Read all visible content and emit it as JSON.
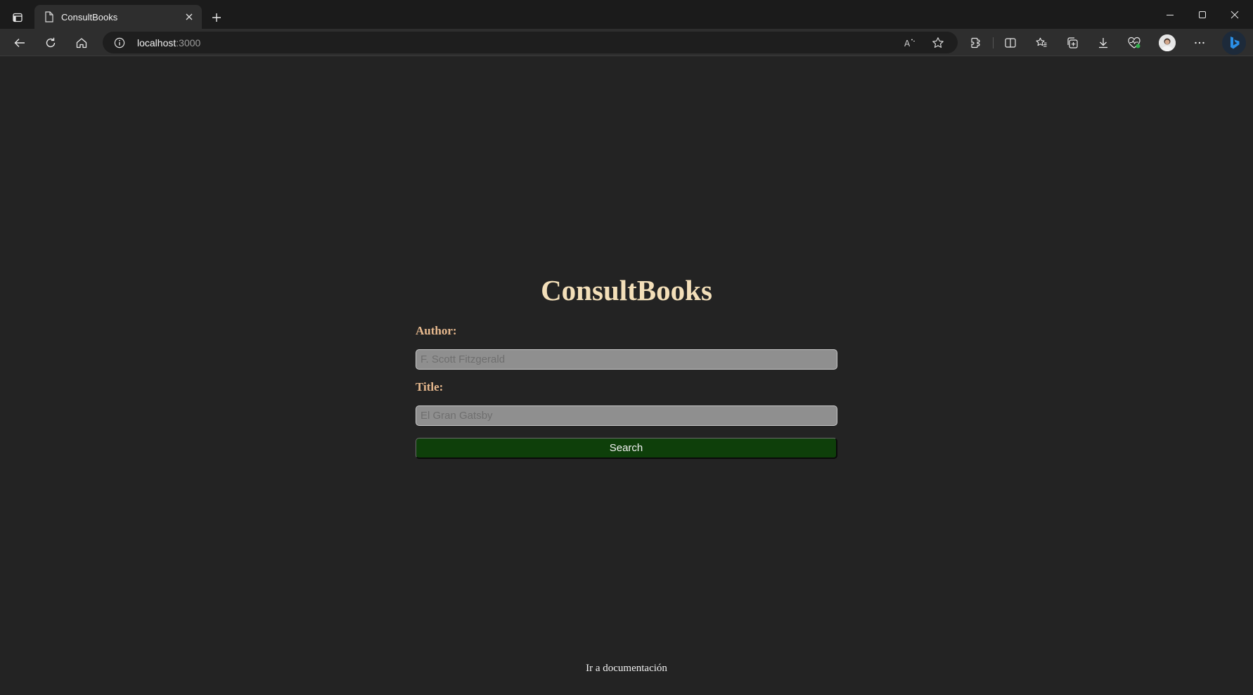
{
  "browser": {
    "tab_title": "ConsultBooks",
    "url_host": "localhost",
    "url_port": ":3000",
    "icons": [
      "tab-actions-icon",
      "page-icon",
      "close-icon",
      "plus-icon",
      "minimize-icon",
      "maximize-icon",
      "window-close-icon",
      "back-icon",
      "refresh-icon",
      "home-icon",
      "info-icon",
      "read-aloud-icon",
      "favorite-star-icon",
      "extensions-icon",
      "split-screen-icon",
      "favorites-icon",
      "collections-icon",
      "downloads-icon",
      "performance-icon",
      "profile-avatar",
      "more-icon",
      "bing-copilot-icon"
    ]
  },
  "app": {
    "title": "ConsultBooks",
    "author_label": "Author:",
    "author_placeholder": "F. Scott Fitzgerald",
    "title_label": "Title:",
    "title_placeholder": "El Gran Gatsby",
    "search_label": "Search",
    "doc_link": "Ir a documentación"
  },
  "colors": {
    "page_bg": "#232323",
    "title": "#f3dfb9",
    "labels": "#e7b98e",
    "input_bg": "#8f8f8f",
    "search_button": "#0e3f0a"
  }
}
